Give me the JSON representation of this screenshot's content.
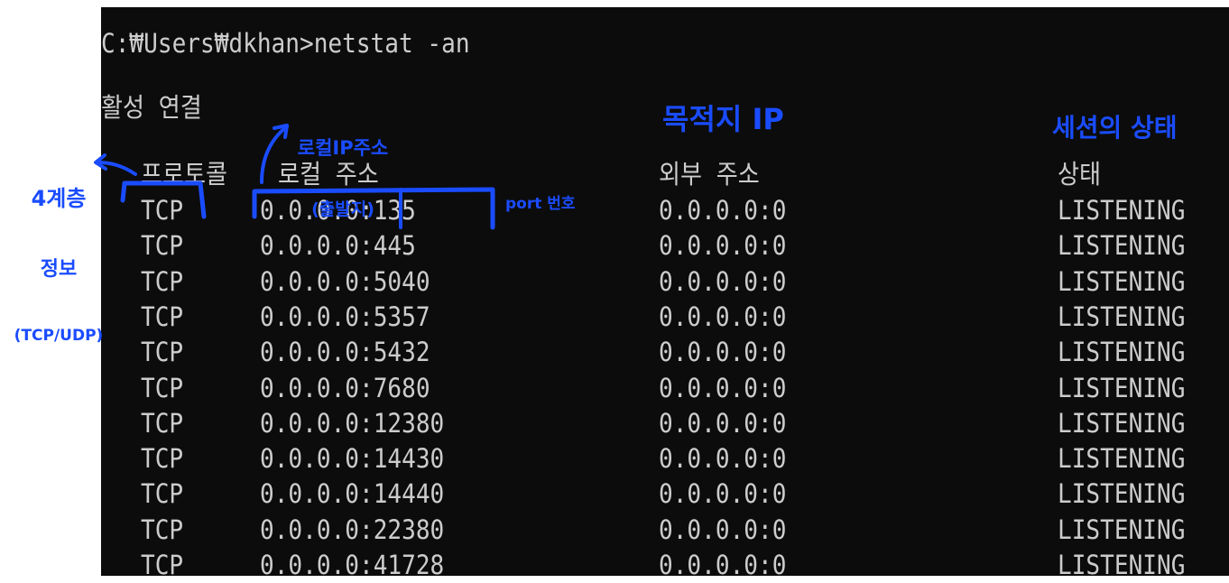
{
  "console": {
    "prompt_line": "C:₩Users₩dkhan>netstat -an",
    "section_title": "활성 연결",
    "headers": {
      "protocol": "프로토콜",
      "local": "로컬 주소",
      "foreign": "외부 주소",
      "state": "상태"
    },
    "rows": [
      {
        "proto": "TCP",
        "local": "0.0.0.0:135",
        "foreign": "0.0.0.0:0",
        "state": "LISTENING"
      },
      {
        "proto": "TCP",
        "local": "0.0.0.0:445",
        "foreign": "0.0.0.0:0",
        "state": "LISTENING"
      },
      {
        "proto": "TCP",
        "local": "0.0.0.0:5040",
        "foreign": "0.0.0.0:0",
        "state": "LISTENING"
      },
      {
        "proto": "TCP",
        "local": "0.0.0.0:5357",
        "foreign": "0.0.0.0:0",
        "state": "LISTENING"
      },
      {
        "proto": "TCP",
        "local": "0.0.0.0:5432",
        "foreign": "0.0.0.0:0",
        "state": "LISTENING"
      },
      {
        "proto": "TCP",
        "local": "0.0.0.0:7680",
        "foreign": "0.0.0.0:0",
        "state": "LISTENING"
      },
      {
        "proto": "TCP",
        "local": "0.0.0.0:12380",
        "foreign": "0.0.0.0:0",
        "state": "LISTENING"
      },
      {
        "proto": "TCP",
        "local": "0.0.0.0:14430",
        "foreign": "0.0.0.0:0",
        "state": "LISTENING"
      },
      {
        "proto": "TCP",
        "local": "0.0.0.0:14440",
        "foreign": "0.0.0.0:0",
        "state": "LISTENING"
      },
      {
        "proto": "TCP",
        "local": "0.0.0.0:22380",
        "foreign": "0.0.0.0:0",
        "state": "LISTENING"
      },
      {
        "proto": "TCP",
        "local": "0.0.0.0:41728",
        "foreign": "0.0.0.0:0",
        "state": "LISTENING"
      }
    ]
  },
  "annotations": {
    "layer4_line1": "4계층",
    "layer4_line2": "정보",
    "layer4_line3": "(TCP/UDP)",
    "local_ip_line1": "로컬IP주소",
    "local_ip_line2": "(출발지)",
    "port_label": "port 번호",
    "dest_ip": "목적지 IP",
    "session_state": "세션의 상태"
  },
  "colors": {
    "console_bg": "#0c0c0c",
    "console_text": "#cccccc",
    "annotation_ink": "#1a4cff"
  }
}
